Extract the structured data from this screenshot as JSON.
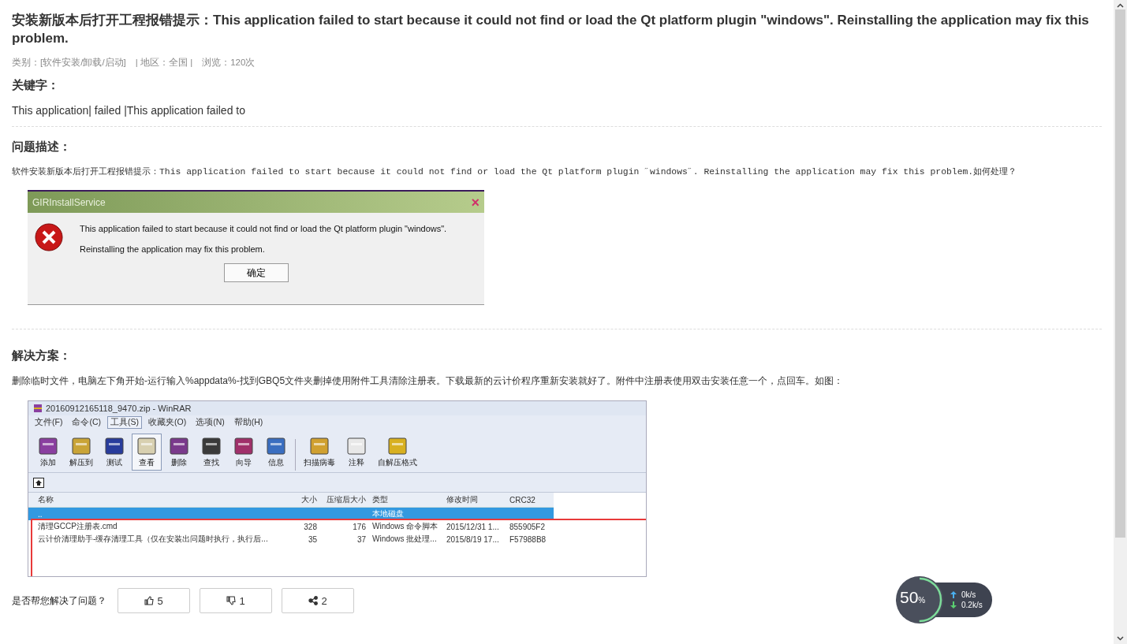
{
  "article": {
    "title": "安装新版本后打开工程报错提示：This application failed to start because it could not find or load the Qt platform plugin \"windows\". Reinstalling the application may fix this problem.",
    "meta": [
      "类别：[软件安装/卸载/启动]",
      "| 地区：全国 |",
      "浏览：120次"
    ]
  },
  "keywords": {
    "heading": "关键字：",
    "text": "This application| failed |This application failed to"
  },
  "problem": {
    "heading": "问题描述：",
    "text": "软件安装新版本后打开工程报错提示：This application failed to start because it could not find or load the Qt platform plugin ˝windows˝. Reinstalling the application may fix this problem.如何处理？",
    "dialog": {
      "title": "GIRInstallService",
      "close": "×",
      "lines": [
        "This application failed to start because it could not find or load the Qt platform plugin \"windows\".",
        "Reinstalling the application may fix this problem."
      ],
      "button": "确定"
    }
  },
  "solution": {
    "heading": "解决方案：",
    "text": "删除临时文件，电脑左下角开始-运行输入%appdata%-找到GBQ5文件夹删掉使用附件工具清除注册表。下载最新的云计价程序重新安装就好了。附件中注册表使用双击安装任意一个，点回车。如图：",
    "winrar": {
      "title": "20160912165118_9470.zip - WinRAR",
      "menu": [
        {
          "label": "文件(F)",
          "selected": false
        },
        {
          "label": "命令(C)",
          "selected": false
        },
        {
          "label": "工具(S)",
          "selected": true
        },
        {
          "label": "收藏夹(O)",
          "selected": false
        },
        {
          "label": "选项(N)",
          "selected": false
        },
        {
          "label": "帮助(H)",
          "selected": false
        }
      ],
      "toolbar": [
        {
          "label": "添加",
          "selected": false,
          "color": "#8a3fa0"
        },
        {
          "label": "解压到",
          "selected": false,
          "color": "#c9a437"
        },
        {
          "label": "测试",
          "selected": false,
          "color": "#283c9c"
        },
        {
          "label": "查看",
          "selected": true,
          "color": "#d8d0b0"
        },
        {
          "label": "删除",
          "selected": false,
          "color": "#7a3a8c"
        },
        {
          "label": "查找",
          "selected": false,
          "color": "#3a3a3a"
        },
        {
          "label": "向导",
          "selected": false,
          "color": "#a0306a"
        },
        {
          "label": "信息",
          "selected": false,
          "color": "#3a6ec0"
        },
        {
          "label": "扫描病毒",
          "selected": false,
          "color": "#d0a030"
        },
        {
          "label": "注释",
          "selected": false,
          "color": "#e8e8e8"
        },
        {
          "label": "自解压格式",
          "selected": false,
          "color": "#d8b020"
        }
      ],
      "columns": [
        "名称",
        "大小",
        "压缩后大小",
        "类型",
        "修改时间",
        "CRC32"
      ],
      "rows": [
        {
          "selected": true,
          "cells": [
            "..",
            "",
            "",
            "本地磁盘",
            "",
            ""
          ]
        },
        {
          "selected": false,
          "cells": [
            "清理GCCP注册表.cmd",
            "328",
            "176",
            "Windows 命令脚本",
            "2015/12/31 1...",
            "855905F2"
          ]
        },
        {
          "selected": false,
          "cells": [
            "云计价清理助手-缓存清理工具（仅在安装出问题时执行，执行后...",
            "35",
            "37",
            "Windows 批处理...",
            "2015/8/19 17...",
            "F57988B8"
          ]
        }
      ]
    }
  },
  "feedback": {
    "question": "是否帮您解决了问题？",
    "buttons": [
      {
        "kind": "like",
        "count": "5"
      },
      {
        "kind": "dislike",
        "count": "1"
      },
      {
        "kind": "share",
        "count": "2"
      }
    ]
  },
  "speed_widget": {
    "percent": "50",
    "unit": "%",
    "level": 0.5,
    "upload": "0k/s",
    "download": "0.2k/s"
  }
}
